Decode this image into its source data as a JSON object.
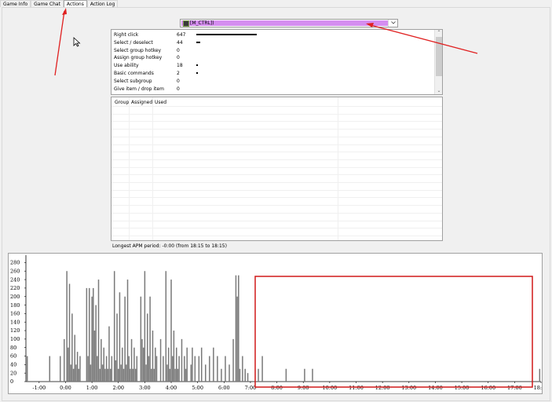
{
  "tabs": [
    "Game Info",
    "Game Chat",
    "Actions",
    "Action Log"
  ],
  "active_tab": 2,
  "player_select": {
    "value": "[M_CTRL])"
  },
  "hotkeys": [
    {
      "label": "Right click",
      "count": "647",
      "value": 647
    },
    {
      "label": "Select / deselect",
      "count": "44",
      "value": 44
    },
    {
      "label": "Select group hotkey",
      "count": "0",
      "value": 0
    },
    {
      "label": "Assign group hotkey",
      "count": "0",
      "value": 0
    },
    {
      "label": "Use ability",
      "count": "18",
      "value": 18
    },
    {
      "label": "Basic commands",
      "count": "2",
      "value": 2
    },
    {
      "label": "Select subgroup",
      "count": "0",
      "value": 0
    },
    {
      "label": "Give item / drop item",
      "count": "0",
      "value": 0
    }
  ],
  "groups_table": {
    "columns": [
      "Group",
      "Assigned",
      "Used"
    ]
  },
  "longest_apm": "Longest APM period: -0:00 (from 18:15 to 18:15)",
  "chart_data": {
    "type": "bar",
    "ylim": [
      0,
      290
    ],
    "yticks": [
      "0",
      "20",
      "40",
      "60",
      "80",
      "100",
      "120",
      "140",
      "160",
      "180",
      "200",
      "220",
      "240",
      "260",
      "280"
    ],
    "ytick_values": [
      0,
      20,
      40,
      60,
      80,
      100,
      120,
      140,
      160,
      180,
      200,
      220,
      240,
      260,
      280
    ],
    "xlim": [
      -1.5,
      18
    ],
    "xticks": [
      "-1:00",
      "0:00",
      "1:00",
      "2:00",
      "3:00",
      "4:00",
      "5:00",
      "6:00",
      "7:00",
      "8:00",
      "9:00",
      "10:00",
      "11:00",
      "12:00",
      "13:00",
      "14:00",
      "15:00",
      "16:00",
      "17:00",
      "18:00"
    ],
    "xtick_values": [
      -1,
      0,
      1,
      2,
      3,
      4,
      5,
      6,
      7,
      8,
      9,
      10,
      11,
      12,
      13,
      14,
      15,
      16,
      17,
      18
    ],
    "bar_color": "#7a7a7a",
    "bars": [
      [
        -1.45,
        60
      ],
      [
        -0.6,
        60
      ],
      [
        -0.2,
        60
      ],
      [
        -0.05,
        100
      ],
      [
        0.05,
        260
      ],
      [
        0.1,
        80
      ],
      [
        0.15,
        230
      ],
      [
        0.2,
        40
      ],
      [
        0.25,
        160
      ],
      [
        0.3,
        30
      ],
      [
        0.35,
        110
      ],
      [
        0.4,
        40
      ],
      [
        0.45,
        70
      ],
      [
        0.5,
        30
      ],
      [
        0.55,
        60
      ],
      [
        0.8,
        220
      ],
      [
        0.85,
        60
      ],
      [
        0.9,
        220
      ],
      [
        0.95,
        40
      ],
      [
        1.0,
        200
      ],
      [
        1.05,
        220
      ],
      [
        1.1,
        120
      ],
      [
        1.15,
        180
      ],
      [
        1.2,
        60
      ],
      [
        1.25,
        240
      ],
      [
        1.3,
        30
      ],
      [
        1.35,
        100
      ],
      [
        1.4,
        40
      ],
      [
        1.45,
        80
      ],
      [
        1.5,
        30
      ],
      [
        1.55,
        60
      ],
      [
        1.6,
        30
      ],
      [
        1.65,
        130
      ],
      [
        1.7,
        30
      ],
      [
        1.75,
        60
      ],
      [
        1.85,
        260
      ],
      [
        1.9,
        50
      ],
      [
        1.95,
        160
      ],
      [
        2.0,
        30
      ],
      [
        2.05,
        210
      ],
      [
        2.1,
        40
      ],
      [
        2.15,
        80
      ],
      [
        2.2,
        30
      ],
      [
        2.25,
        200
      ],
      [
        2.3,
        40
      ],
      [
        2.35,
        240
      ],
      [
        2.4,
        60
      ],
      [
        2.45,
        30
      ],
      [
        2.5,
        100
      ],
      [
        2.55,
        30
      ],
      [
        2.6,
        80
      ],
      [
        2.65,
        30
      ],
      [
        2.7,
        60
      ],
      [
        2.85,
        200
      ],
      [
        2.9,
        100
      ],
      [
        2.95,
        80
      ],
      [
        3.0,
        260
      ],
      [
        3.05,
        40
      ],
      [
        3.1,
        160
      ],
      [
        3.15,
        60
      ],
      [
        3.2,
        200
      ],
      [
        3.25,
        30
      ],
      [
        3.3,
        120
      ],
      [
        3.35,
        30
      ],
      [
        3.4,
        80
      ],
      [
        3.45,
        60
      ],
      [
        3.6,
        100
      ],
      [
        3.7,
        60
      ],
      [
        3.8,
        260
      ],
      [
        3.85,
        40
      ],
      [
        3.9,
        80
      ],
      [
        3.95,
        30
      ],
      [
        4.0,
        240
      ],
      [
        4.05,
        60
      ],
      [
        4.1,
        120
      ],
      [
        4.15,
        30
      ],
      [
        4.2,
        80
      ],
      [
        4.25,
        30
      ],
      [
        4.3,
        60
      ],
      [
        4.4,
        100
      ],
      [
        4.5,
        60
      ],
      [
        4.55,
        30
      ],
      [
        4.6,
        80
      ],
      [
        4.75,
        40
      ],
      [
        4.8,
        80
      ],
      [
        4.9,
        60
      ],
      [
        5.05,
        60
      ],
      [
        5.15,
        80
      ],
      [
        5.3,
        40
      ],
      [
        5.45,
        60
      ],
      [
        5.6,
        80
      ],
      [
        5.75,
        60
      ],
      [
        5.9,
        30
      ],
      [
        6.05,
        60
      ],
      [
        6.2,
        40
      ],
      [
        6.35,
        100
      ],
      [
        6.45,
        250
      ],
      [
        6.5,
        200
      ],
      [
        6.55,
        250
      ],
      [
        6.6,
        30
      ],
      [
        6.7,
        60
      ],
      [
        6.8,
        30
      ],
      [
        6.9,
        20
      ],
      [
        7.3,
        30
      ],
      [
        7.45,
        60
      ],
      [
        8.35,
        30
      ],
      [
        9.05,
        30
      ],
      [
        9.35,
        30
      ],
      [
        17.95,
        30
      ]
    ]
  },
  "colors": {
    "selection": "#d58ef0",
    "annotation": "#e02020"
  }
}
